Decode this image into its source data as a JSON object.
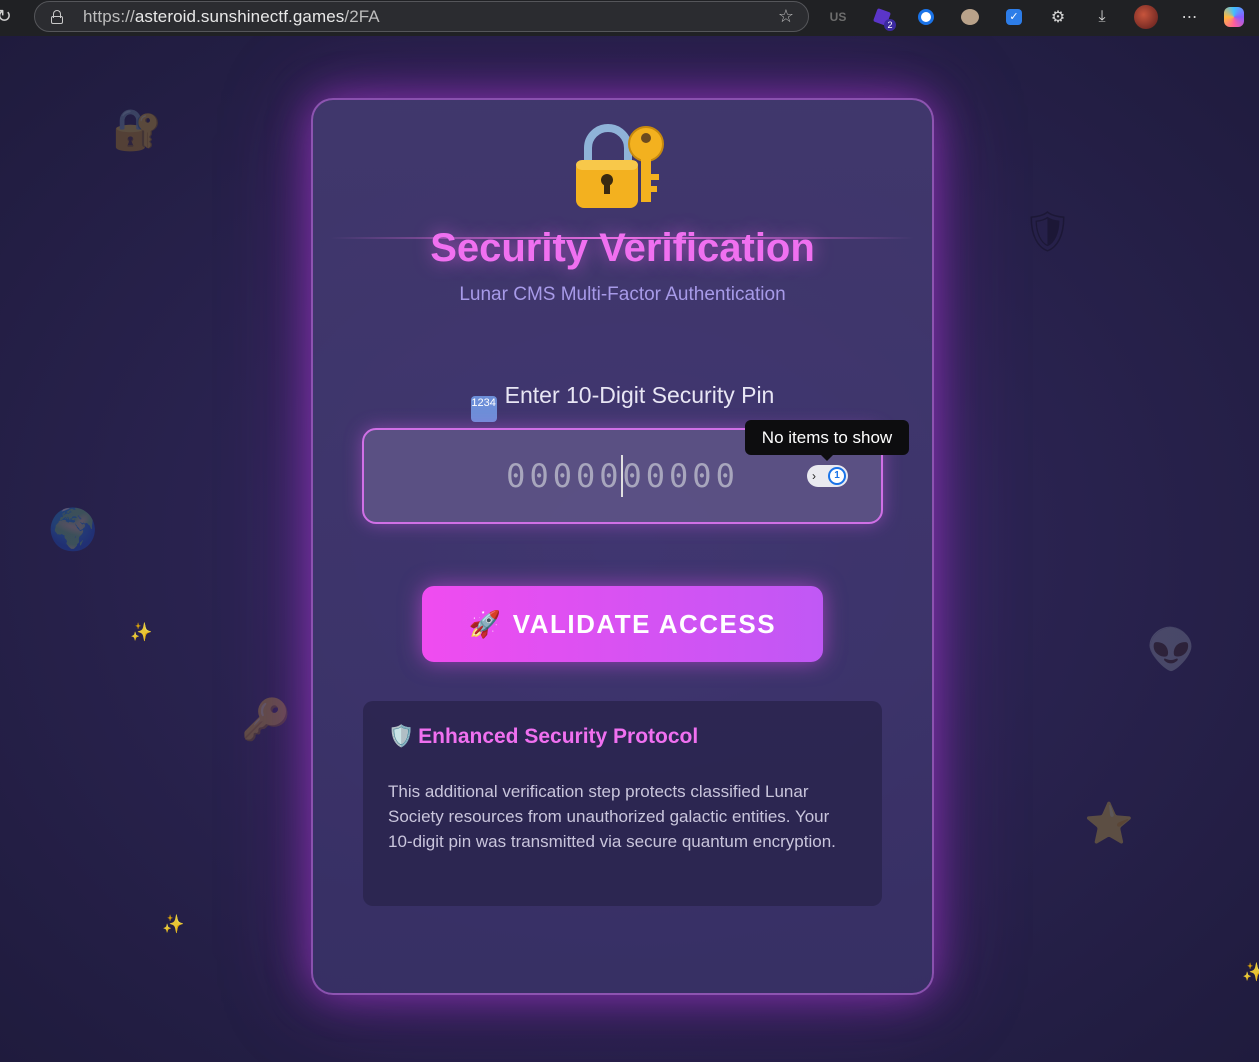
{
  "browser": {
    "url_scheme": "https://",
    "url_host": "asteroid.sunshinectf.games",
    "url_path": "/2FA",
    "extensions": {
      "us_label": "US",
      "badge_count": "2"
    }
  },
  "card": {
    "icon": "lock-with-key-icon",
    "title": "Security Verification",
    "subtitle": "Lunar CMS Multi-Factor Authentication",
    "pin_label": "Enter 10-Digit Security Pin",
    "pin_keypad_glyph": "1234",
    "pin_placeholder": "0000000000",
    "pin_value": "",
    "tooltip": "No items to show",
    "validate_button": "VALIDATE ACCESS",
    "info": {
      "title": "Enhanced Security Protocol",
      "text": "This additional verification step protects classified Lunar Society resources from unauthorized galactic entities. Your 10-digit pin was transmitted via secure quantum encryption."
    }
  },
  "colors": {
    "accent": "#f070f0",
    "button_start": "#f04cf0",
    "button_end": "#c058f5",
    "subtitle": "#a79ae8"
  }
}
